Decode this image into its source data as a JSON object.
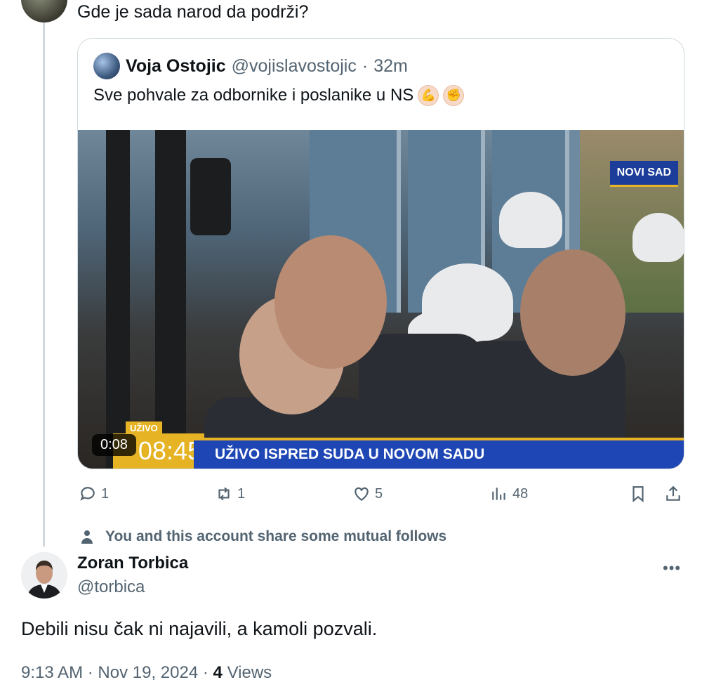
{
  "previous_tweet": {
    "text": "Gde je sada narod da podrži?"
  },
  "quoted_tweet": {
    "name": "Voja Ostojic",
    "handle": "@vojislavostojic",
    "separator": "·",
    "time": "32m",
    "text": "Sve pohvale za odbornike i poslanike u NS",
    "emojis": [
      "flexed-biceps-emoji",
      "raised-fist-emoji"
    ],
    "video": {
      "duration": "0:08",
      "tag": "NOVI SAD",
      "live_label": "UŽIVO",
      "clock": "08:45",
      "headline": "UŽIVO ISPRED SUDA U NOVOM SADU"
    }
  },
  "actions": {
    "replies": "1",
    "reposts": "1",
    "likes": "5",
    "views": "48"
  },
  "mutual_follows": "You and this account share some mutual follows",
  "main_tweet": {
    "name": "Zoran Torbica",
    "handle": "@torbica",
    "more": "•••",
    "text": "Debili nisu čak ni najavili, a kamoli pozvali.",
    "time": "9:13 AM",
    "date": "Nov 19, 2024",
    "dot": "·",
    "views_count": "4",
    "views_label": "Views"
  },
  "colors": {
    "text": "#0f1419",
    "muted": "#536471",
    "border": "#cfd9de",
    "tv_blue": "#1e46b4",
    "tv_yellow": "#e5b323"
  }
}
